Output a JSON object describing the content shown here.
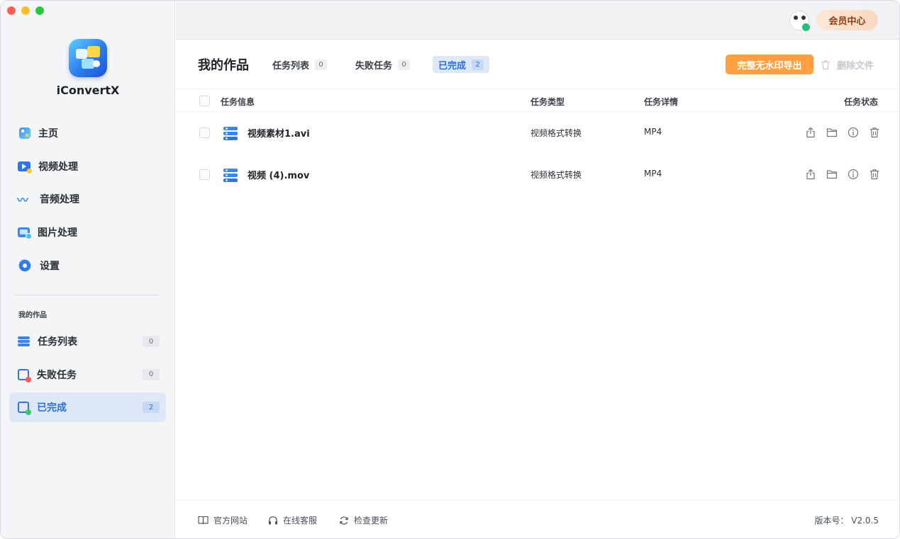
{
  "app": {
    "name": "iConvertX"
  },
  "sidebar": {
    "main_items": [
      {
        "label": "主页"
      },
      {
        "label": "视频处理"
      },
      {
        "label": "音频处理"
      },
      {
        "label": "图片处理"
      },
      {
        "label": "设置"
      }
    ],
    "section_label": "我的作品",
    "works_items": [
      {
        "label": "任务列表",
        "count": "0"
      },
      {
        "label": "失败任务",
        "count": "0"
      },
      {
        "label": "已完成",
        "count": "2"
      }
    ]
  },
  "topbar": {
    "vip_label": "会员中心"
  },
  "main": {
    "title": "我的作品",
    "tabs": [
      {
        "label": "任务列表",
        "count": "0"
      },
      {
        "label": "失败任务",
        "count": "0"
      },
      {
        "label": "已完成",
        "count": "2"
      }
    ],
    "export_label": "完整无水印导出",
    "delete_label": "删除文件",
    "columns": {
      "info": "任务信息",
      "type": "任务类型",
      "detail": "任务详情",
      "status": "任务状态"
    },
    "rows": [
      {
        "name": "视频素材1.avi",
        "type": "视频格式转换",
        "detail": "MP4"
      },
      {
        "name": "视频 (4).mov",
        "type": "视频格式转换",
        "detail": "MP4"
      }
    ]
  },
  "footer": {
    "website": "官方网站",
    "support": "在线客服",
    "update": "检查更新",
    "version": "版本号： V2.0.5"
  },
  "colors": {
    "accent": "#2b6fe0",
    "export": "#ff9f3f",
    "active_bg": "#dde8f9"
  }
}
